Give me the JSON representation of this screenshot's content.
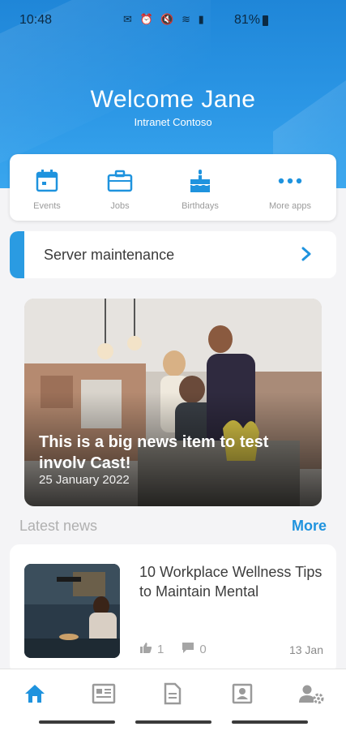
{
  "status_bar": {
    "time": "10:48",
    "battery": "81%",
    "icons": "✉ ⏰ 🔇 ≋ ▮"
  },
  "header": {
    "welcome": "Welcome Jane",
    "subtitle": "Intranet Contoso"
  },
  "apps": [
    {
      "label": "Events",
      "icon": "calendar-icon"
    },
    {
      "label": "Jobs",
      "icon": "briefcase-icon"
    },
    {
      "label": "Birthdays",
      "icon": "cake-icon"
    },
    {
      "label": "More apps",
      "icon": "more-dots-icon"
    }
  ],
  "alert": {
    "text": "Server maintenance"
  },
  "featured": {
    "title": "This is a big news item to test involv Cast!",
    "date": "25 January 2022"
  },
  "latest": {
    "title": "Latest news",
    "more": "More",
    "items": [
      {
        "title": "10 Workplace Wellness Tips to Maintain Mental",
        "likes": "1",
        "comments": "0",
        "date": "13 Jan"
      }
    ]
  },
  "bottom_nav": [
    "home-icon",
    "news-icon",
    "document-icon",
    "contact-icon",
    "user-settings-icon"
  ],
  "colors": {
    "accent": "#1f93de",
    "header": "#2b96e5"
  }
}
